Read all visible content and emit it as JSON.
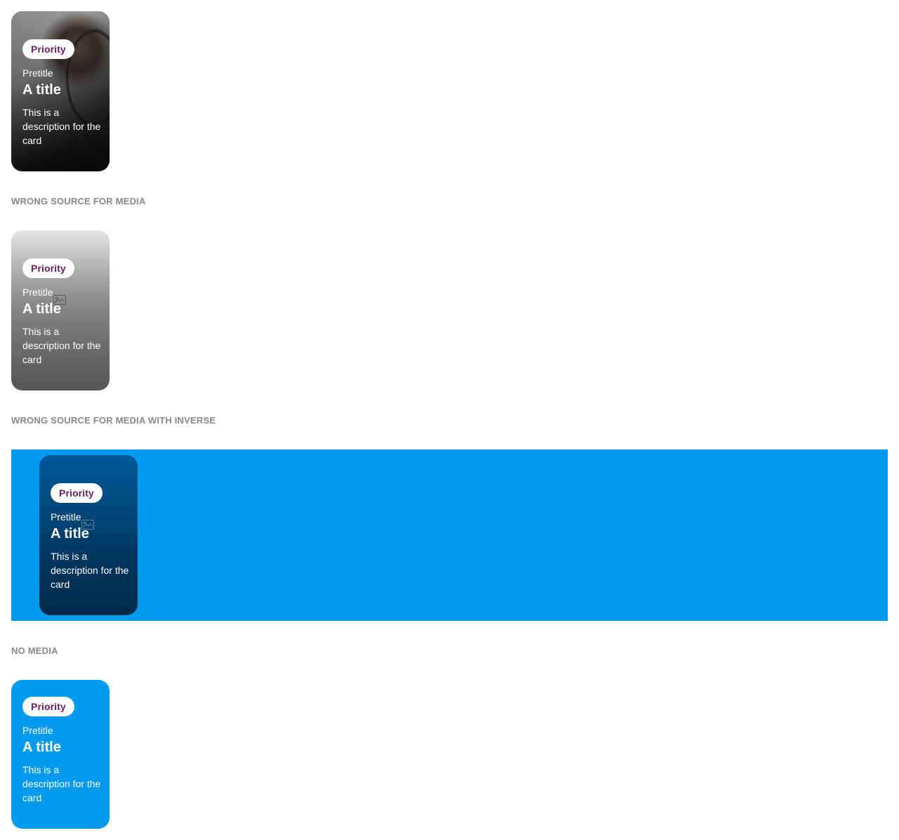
{
  "colors": {
    "page_bg": "#ffffff",
    "label_text": "#888888",
    "badge_bg": "#ffffff",
    "badge_text": "#6b1f63",
    "inverse_bg": "#009af0",
    "no_media_card_bg": "#009af0"
  },
  "sections": [
    {
      "label": "",
      "card": {
        "badge": "Priority",
        "pretitle": "Pretitle",
        "title": "A title",
        "description": "This is a description for the card",
        "media": "photo"
      }
    },
    {
      "label": "WRONG SOURCE FOR MEDIA",
      "card": {
        "badge": "Priority",
        "pretitle": "Pretitle",
        "title": "A title",
        "description": "This is a description for the card",
        "media": "broken-image-icon"
      }
    },
    {
      "label": "WRONG SOURCE FOR MEDIA WITH INVERSE",
      "card": {
        "badge": "Priority",
        "pretitle": "Pretitle",
        "title": "A title",
        "description": "This is a description for the card",
        "media": "broken-image-icon"
      }
    },
    {
      "label": "NO MEDIA",
      "card": {
        "badge": "Priority",
        "pretitle": "Pretitle",
        "title": "A title",
        "description": "This is a description for the card",
        "media": "none"
      }
    }
  ]
}
